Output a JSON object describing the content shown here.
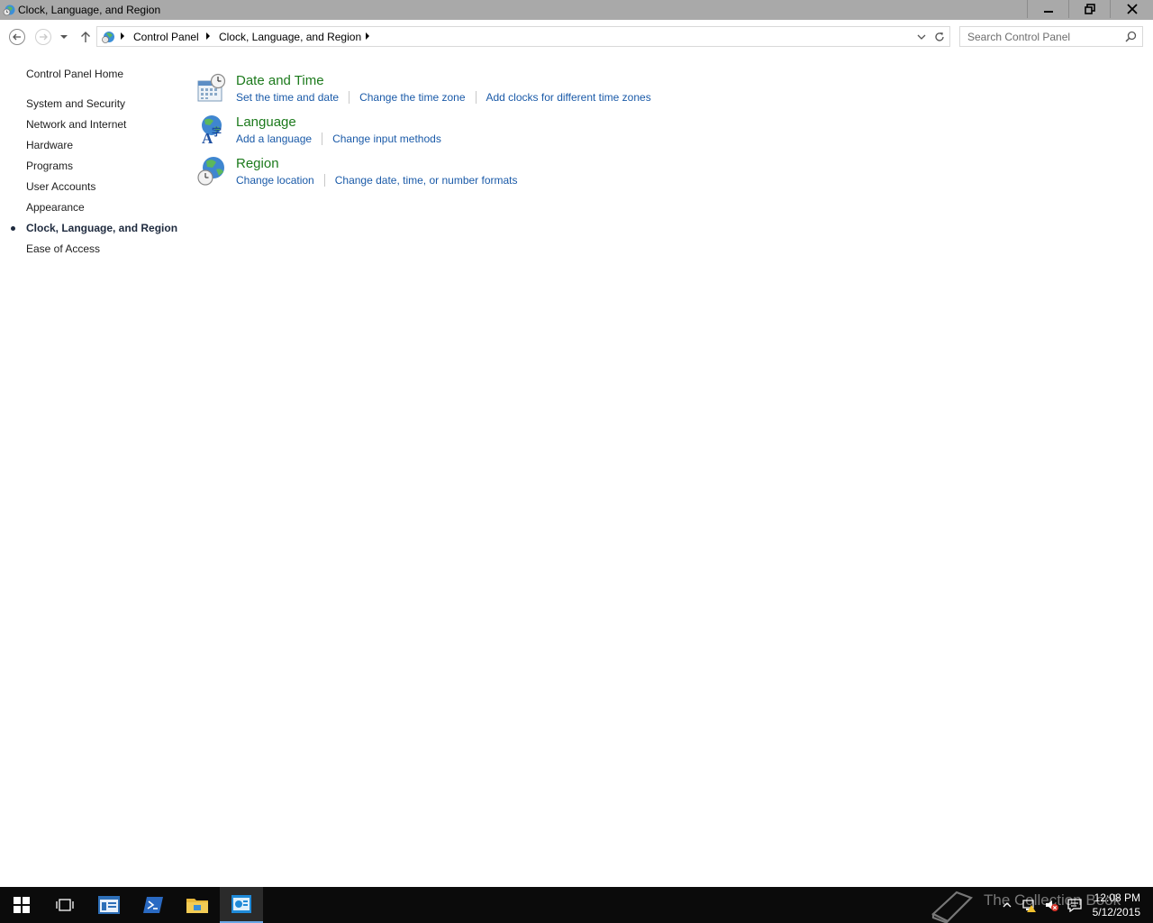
{
  "window": {
    "title": "Clock, Language, and Region"
  },
  "address": {
    "crumbs": [
      "Control Panel",
      "Clock, Language, and Region"
    ]
  },
  "search": {
    "placeholder": "Search Control Panel"
  },
  "sidebar": {
    "home": "Control Panel Home",
    "items": [
      {
        "label": "System and Security"
      },
      {
        "label": "Network and Internet"
      },
      {
        "label": "Hardware"
      },
      {
        "label": "Programs"
      },
      {
        "label": "User Accounts"
      },
      {
        "label": "Appearance"
      },
      {
        "label": "Clock, Language, and Region",
        "active": true
      },
      {
        "label": "Ease of Access"
      }
    ]
  },
  "categories": [
    {
      "title": "Date and Time",
      "icon": "date-time-icon",
      "links": [
        "Set the time and date",
        "Change the time zone",
        "Add clocks for different time zones"
      ]
    },
    {
      "title": "Language",
      "icon": "language-icon",
      "links": [
        "Add a language",
        "Change input methods"
      ]
    },
    {
      "title": "Region",
      "icon": "region-icon",
      "links": [
        "Change location",
        "Change date, time, or number formats"
      ]
    }
  ],
  "taskbar": {
    "clock_time": "12:08 PM",
    "clock_date": "5/12/2015",
    "watermark": "The Collection Book"
  },
  "colors": {
    "category_title": "#1c7a1c",
    "link": "#1a5aa8",
    "titlebar": "#a9a9a9",
    "taskbar": "#0b0b0b"
  }
}
